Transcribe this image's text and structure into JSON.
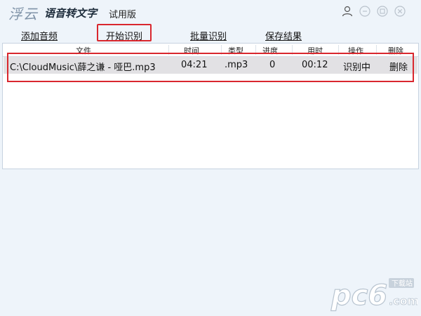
{
  "app": {
    "logo_text": "浮云",
    "name": "语音转文字",
    "edition": "试用版"
  },
  "title_controls": [
    {
      "name": "user-icon"
    },
    {
      "name": "minimize-icon"
    },
    {
      "name": "restore-icon"
    },
    {
      "name": "close-icon"
    }
  ],
  "menu": {
    "add_audio": "添加音频",
    "start_recognition": "开始识别",
    "batch_recognition": "批量识别",
    "save_results": "保存结果"
  },
  "table": {
    "headers": {
      "file": "文件",
      "duration": "时间",
      "type": "类型",
      "progress": "进度",
      "elapsed": "用时",
      "action": "操作",
      "delete": "删除"
    },
    "rows": [
      {
        "file": "C:\\CloudMusic\\薛之谦 - 哑巴.mp3",
        "duration": "04:21",
        "type": ".mp3",
        "progress": "0",
        "elapsed": "00:12",
        "action": "识别中",
        "delete": "删除"
      }
    ]
  },
  "watermark": {
    "brand": "pc6",
    "tag": "下载站",
    "domain": ".com"
  },
  "colors": {
    "window_bg": "#eef4fa",
    "highlight_red": "#d9272e",
    "row_bg": "#e2e1e4",
    "logo_gray": "#7f93a8"
  }
}
